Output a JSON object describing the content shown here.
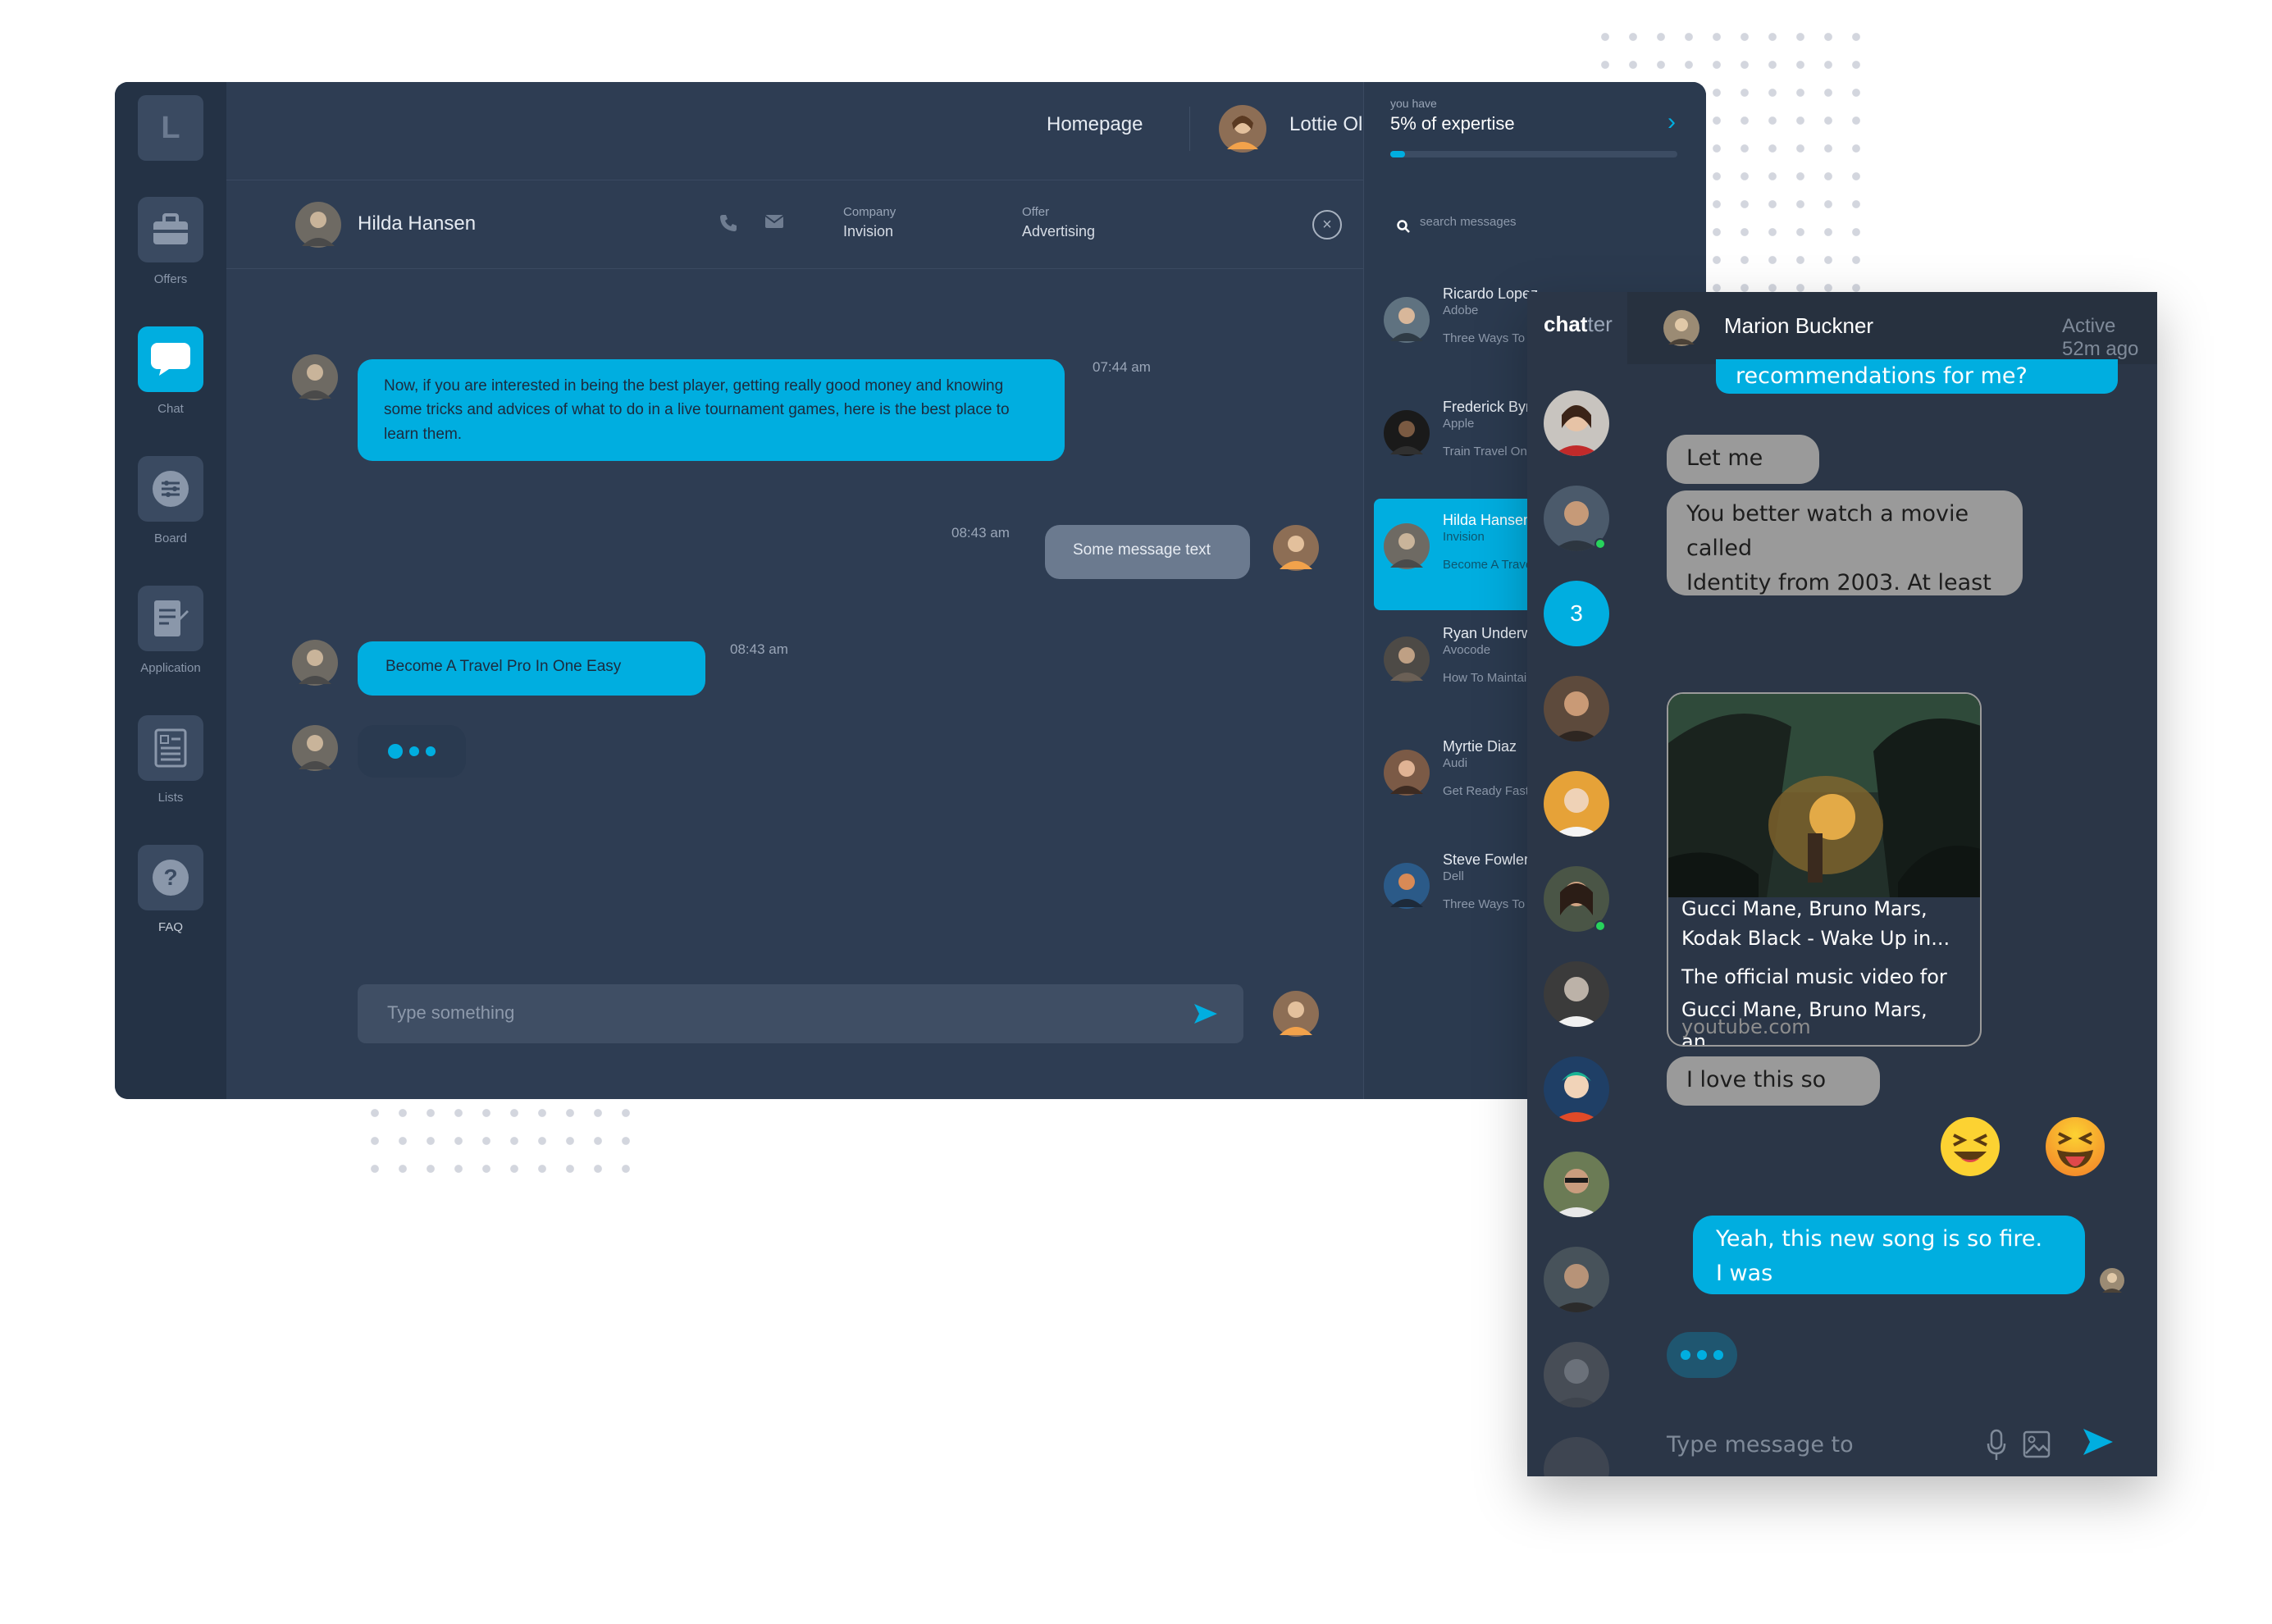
{
  "dashboard": {
    "logo_letter": "L",
    "nav": [
      {
        "label": "Offers",
        "icon": "briefcase-icon"
      },
      {
        "label": "Chat",
        "icon": "chat-bubble-icon",
        "active": true
      },
      {
        "label": "Board",
        "icon": "sliders-icon"
      },
      {
        "label": "Application",
        "icon": "document-edit-icon"
      },
      {
        "label": "Lists",
        "icon": "list-document-icon"
      },
      {
        "label": "FAQ",
        "icon": "question-icon"
      }
    ],
    "topbar": {
      "homepage": "Homepage",
      "user_name": "Lottie Oliver",
      "expertise_small": "you have",
      "expertise_big": "5% of expertise",
      "expertise_percent": 5
    },
    "chat_header": {
      "name": "Hilda Hansen",
      "company_label": "Company",
      "company_value": "Invision",
      "offer_label": "Offer",
      "offer_value": "Advertising"
    },
    "messages": [
      {
        "text": "Now, if you are interested in being the best player, getting really good money and knowing some tricks and advices of what to do in a live tournament games, here is the best place to learn them.",
        "time": "07:44 am"
      },
      {
        "text": "Some message text",
        "time": "08:43 am"
      },
      {
        "text": "Become A Travel Pro In One Easy",
        "time": "08:43 am"
      }
    ],
    "input_placeholder": "Type something",
    "search_placeholder": "search messages",
    "conversations": [
      {
        "name": "Ricardo Lopez",
        "company": "Adobe",
        "preview": "Three Ways To"
      },
      {
        "name": "Frederick Byrd",
        "company": "Apple",
        "preview": "Train Travel On"
      },
      {
        "name": "Hilda Hansen",
        "company": "Invision",
        "preview": "Become A Travel",
        "active": true
      },
      {
        "name": "Ryan Underwood",
        "company": "Avocode",
        "preview": "How To Maintain"
      },
      {
        "name": "Myrtie Diaz",
        "company": "Audi",
        "preview": "Get Ready Fast"
      },
      {
        "name": "Steve Fowler",
        "company": "Dell",
        "preview": "Three Ways To"
      }
    ]
  },
  "chatter": {
    "logo_bold": "chat",
    "logo_light": "ter",
    "contact_name": "Marion Buckner",
    "active_status": "Active 52m ago",
    "unread_count": "3",
    "messages": {
      "top_partial": "recommendations for me?",
      "let_me": "Let me",
      "movie_line1": "You better watch a movie",
      "movie_line2": "called",
      "movie_line3": "Identity from 2003. At least",
      "yt_title_1": "Gucci Mane, Bruno Mars,",
      "yt_title_2": "Kodak Black - Wake Up in...",
      "yt_desc_1": "The official music video for",
      "yt_desc_2": "Gucci Mane, Bruno Mars, an...",
      "yt_url": "youtube.com",
      "love": "I love this so",
      "reply_1": "Yeah, this new song is so fire.",
      "reply_2": "I was"
    },
    "input_placeholder": "Type message to"
  }
}
